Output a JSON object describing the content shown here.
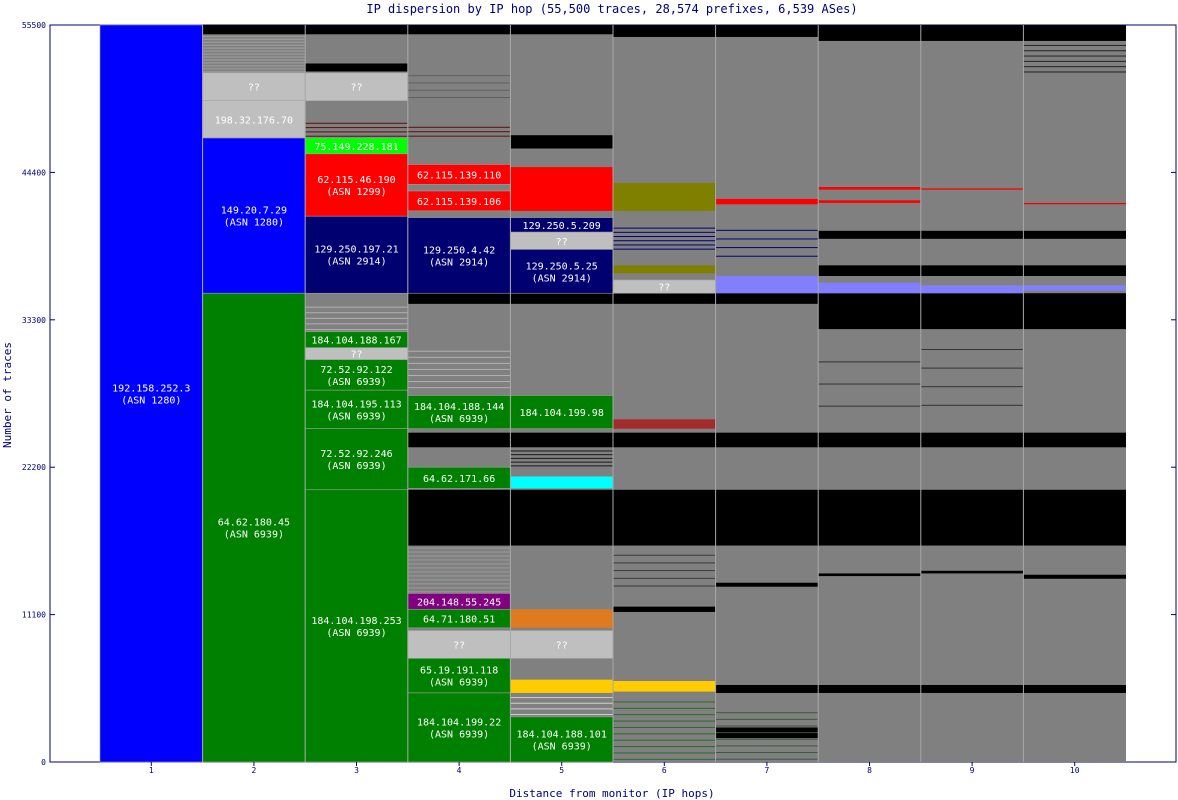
{
  "chart_data": {
    "type": "bar",
    "title": "IP dispersion by IP hop (55,500 traces, 28,574 prefixes, 6,539 ASes)",
    "xlabel": "Distance from monitor (IP hops)",
    "ylabel": "Number of traces",
    "ylim": [
      0,
      55500
    ],
    "yticks": [
      "0",
      "11100",
      "22200",
      "33300",
      "44400",
      "55500"
    ],
    "categories": [
      "1",
      "2",
      "3",
      "4",
      "5",
      "6",
      "7",
      "8",
      "9",
      "10"
    ],
    "colors": {
      "blue": "#0000ff",
      "navy": "#000070",
      "green": "#008000",
      "gray": "#808080",
      "lightgray": "#bfbfbf",
      "black": "#000000",
      "red": "#ff0000",
      "lime": "#00ff00",
      "olive": "#808000",
      "cyan": "#00ffff",
      "purple": "#800080",
      "orange": "#e07a1f",
      "gold": "#ffcc00",
      "brown": "#a52a2a",
      "lightblue": "#8080ff",
      "axis": "#00007a"
    },
    "labeled_segments": [
      {
        "hop": 1,
        "y0": 0,
        "y1": 55500,
        "color": "blue",
        "label": "192.158.252.3",
        "sub": "(ASN 1280)"
      },
      {
        "hop": 2,
        "y0": 35300,
        "y1": 47000,
        "color": "blue",
        "label": "149.20.7.29",
        "sub": "(ASN 1280)"
      },
      {
        "hop": 2,
        "y0": 0,
        "y1": 35300,
        "color": "green",
        "label": "64.62.180.45",
        "sub": "(ASN 6939)"
      },
      {
        "hop": 2,
        "y0": 47000,
        "y1": 49800,
        "color": "lightgray",
        "label": "198.32.176.70",
        "sub": ""
      },
      {
        "hop": 2,
        "y0": 49800,
        "y1": 51900,
        "color": "lightgray",
        "label": "??",
        "sub": ""
      },
      {
        "hop": 3,
        "y0": 45800,
        "y1": 47000,
        "color": "lime",
        "label": "75.149.228.181",
        "sub": ""
      },
      {
        "hop": 3,
        "y0": 41100,
        "y1": 45800,
        "color": "red",
        "label": "62.115.46.190",
        "sub": "(ASN 1299)"
      },
      {
        "hop": 3,
        "y0": 35300,
        "y1": 41100,
        "color": "navy",
        "label": "129.250.197.21",
        "sub": "(ASN 2914)"
      },
      {
        "hop": 3,
        "y0": 49800,
        "y1": 51900,
        "color": "lightgray",
        "label": "??",
        "sub": ""
      },
      {
        "hop": 3,
        "y0": 31200,
        "y1": 32400,
        "color": "green",
        "label": "184.104.188.167",
        "sub": ""
      },
      {
        "hop": 3,
        "y0": 30300,
        "y1": 31200,
        "color": "lightgray",
        "label": "??",
        "sub": ""
      },
      {
        "hop": 3,
        "y0": 28000,
        "y1": 30300,
        "color": "green",
        "label": "72.52.92.122",
        "sub": "(ASN 6939)"
      },
      {
        "hop": 3,
        "y0": 25100,
        "y1": 28000,
        "color": "green",
        "label": "184.104.195.113",
        "sub": "(ASN 6939)"
      },
      {
        "hop": 3,
        "y0": 20500,
        "y1": 25100,
        "color": "green",
        "label": "72.52.92.246",
        "sub": "(ASN 6939)"
      },
      {
        "hop": 3,
        "y0": 0,
        "y1": 20500,
        "color": "green",
        "label": "184.104.198.253",
        "sub": "(ASN 6939)"
      },
      {
        "hop": 4,
        "y0": 43500,
        "y1": 45000,
        "color": "red",
        "label": "62.115.139.110",
        "sub": ""
      },
      {
        "hop": 4,
        "y0": 41500,
        "y1": 43000,
        "color": "red",
        "label": "62.115.139.106",
        "sub": ""
      },
      {
        "hop": 4,
        "y0": 35300,
        "y1": 41000,
        "color": "navy",
        "label": "129.250.4.42",
        "sub": "(ASN 2914)"
      },
      {
        "hop": 4,
        "y0": 25100,
        "y1": 27600,
        "color": "green",
        "label": "184.104.188.144",
        "sub": "(ASN 6939)"
      },
      {
        "hop": 4,
        "y0": 20600,
        "y1": 22200,
        "color": "green",
        "label": "64.62.171.66",
        "sub": ""
      },
      {
        "hop": 4,
        "y0": 11500,
        "y1": 12700,
        "color": "purple",
        "label": "204.148.55.245",
        "sub": ""
      },
      {
        "hop": 4,
        "y0": 10100,
        "y1": 11500,
        "color": "green",
        "label": "64.71.180.51",
        "sub": ""
      },
      {
        "hop": 4,
        "y0": 7800,
        "y1": 9900,
        "color": "lightgray",
        "label": "??",
        "sub": ""
      },
      {
        "hop": 4,
        "y0": 5200,
        "y1": 7800,
        "color": "green",
        "label": "65.19.191.118",
        "sub": "(ASN 6939)"
      },
      {
        "hop": 4,
        "y0": 0,
        "y1": 5200,
        "color": "green",
        "label": "184.104.199.22",
        "sub": "(ASN 6939)"
      },
      {
        "hop": 5,
        "y0": 39900,
        "y1": 41000,
        "color": "navy",
        "label": "129.250.5.209",
        "sub": ""
      },
      {
        "hop": 5,
        "y0": 38600,
        "y1": 39900,
        "color": "lightgray",
        "label": "??",
        "sub": ""
      },
      {
        "hop": 5,
        "y0": 35300,
        "y1": 38600,
        "color": "navy",
        "label": "129.250.5.25",
        "sub": "(ASN 2914)"
      },
      {
        "hop": 5,
        "y0": 25100,
        "y1": 27600,
        "color": "green",
        "label": "184.104.199.98",
        "sub": ""
      },
      {
        "hop": 5,
        "y0": 7800,
        "y1": 9900,
        "color": "lightgray",
        "label": "??",
        "sub": ""
      },
      {
        "hop": 5,
        "y0": 0,
        "y1": 3400,
        "color": "green",
        "label": "184.104.188.101",
        "sub": "(ASN 6939)"
      },
      {
        "hop": 6,
        "y0": 35300,
        "y1": 36300,
        "color": "lightgray",
        "label": "??",
        "sub": ""
      }
    ],
    "unlabeled_segments": [
      {
        "hop": 5,
        "y0": 20600,
        "y1": 21500,
        "color": "cyan"
      },
      {
        "hop": 5,
        "y0": 10100,
        "y1": 11500,
        "color": "orange"
      },
      {
        "hop": 5,
        "y0": 5200,
        "y1": 6200,
        "color": "gold"
      },
      {
        "hop": 5,
        "y0": 41500,
        "y1": 44800,
        "color": "red"
      },
      {
        "hop": 6,
        "y0": 41500,
        "y1": 43600,
        "color": "olive"
      },
      {
        "hop": 6,
        "y0": 36800,
        "y1": 37400,
        "color": "olive"
      },
      {
        "hop": 6,
        "y0": 5300,
        "y1": 6100,
        "color": "gold"
      },
      {
        "hop": 6,
        "y0": 25100,
        "y1": 25800,
        "color": "brown"
      },
      {
        "hop": 7,
        "y0": 35300,
        "y1": 36600,
        "color": "lightblue"
      },
      {
        "hop": 8,
        "y0": 35300,
        "y1": 36100,
        "color": "lightblue"
      },
      {
        "hop": 9,
        "y0": 35300,
        "y1": 35900,
        "color": "lightblue"
      },
      {
        "hop": 10,
        "y0": 35500,
        "y1": 35900,
        "color": "lightblue"
      },
      {
        "hop": 7,
        "y0": 42000,
        "y1": 42400,
        "color": "red"
      },
      {
        "hop": 8,
        "y0": 43100,
        "y1": 43300,
        "color": "red"
      },
      {
        "hop": 8,
        "y0": 42100,
        "y1": 42300,
        "color": "red"
      },
      {
        "hop": 9,
        "y0": 43100,
        "y1": 43200,
        "color": "red"
      },
      {
        "hop": 10,
        "y0": 42000,
        "y1": 42100,
        "color": "red"
      }
    ],
    "black_segments": [
      {
        "hop": 2,
        "y0": 54800,
        "y1": 55500
      },
      {
        "hop": 3,
        "y0": 54800,
        "y1": 55500
      },
      {
        "hop": 4,
        "y0": 54800,
        "y1": 55500
      },
      {
        "hop": 5,
        "y0": 54800,
        "y1": 55500
      },
      {
        "hop": 6,
        "y0": 54600,
        "y1": 55500
      },
      {
        "hop": 7,
        "y0": 54600,
        "y1": 55500
      },
      {
        "hop": 8,
        "y0": 54300,
        "y1": 55500
      },
      {
        "hop": 9,
        "y0": 54300,
        "y1": 55500
      },
      {
        "hop": 10,
        "y0": 54300,
        "y1": 55500
      },
      {
        "hop": 4,
        "y0": 16300,
        "y1": 20500
      },
      {
        "hop": 5,
        "y0": 16300,
        "y1": 20500
      },
      {
        "hop": 6,
        "y0": 16300,
        "y1": 20500
      },
      {
        "hop": 7,
        "y0": 16300,
        "y1": 20500
      },
      {
        "hop": 8,
        "y0": 16300,
        "y1": 20500
      },
      {
        "hop": 9,
        "y0": 16300,
        "y1": 20500
      },
      {
        "hop": 10,
        "y0": 16300,
        "y1": 20500
      },
      {
        "hop": 4,
        "y0": 23700,
        "y1": 24800
      },
      {
        "hop": 5,
        "y0": 23700,
        "y1": 24800
      },
      {
        "hop": 6,
        "y0": 23700,
        "y1": 24800
      },
      {
        "hop": 7,
        "y0": 23700,
        "y1": 24800
      },
      {
        "hop": 8,
        "y0": 23700,
        "y1": 24800
      },
      {
        "hop": 9,
        "y0": 23700,
        "y1": 24800
      },
      {
        "hop": 10,
        "y0": 23700,
        "y1": 24800
      },
      {
        "hop": 4,
        "y0": 34500,
        "y1": 35300
      },
      {
        "hop": 5,
        "y0": 34500,
        "y1": 35300
      },
      {
        "hop": 6,
        "y0": 34500,
        "y1": 35300
      },
      {
        "hop": 7,
        "y0": 34500,
        "y1": 35300
      },
      {
        "hop": 8,
        "y0": 32600,
        "y1": 35300
      },
      {
        "hop": 9,
        "y0": 32600,
        "y1": 35300
      },
      {
        "hop": 10,
        "y0": 32600,
        "y1": 35300
      },
      {
        "hop": 8,
        "y0": 36600,
        "y1": 37400
      },
      {
        "hop": 9,
        "y0": 36600,
        "y1": 37400
      },
      {
        "hop": 10,
        "y0": 36600,
        "y1": 37400
      },
      {
        "hop": 8,
        "y0": 39400,
        "y1": 40000
      },
      {
        "hop": 9,
        "y0": 39400,
        "y1": 40000
      },
      {
        "hop": 10,
        "y0": 39400,
        "y1": 40000
      },
      {
        "hop": 7,
        "y0": 5200,
        "y1": 5800
      },
      {
        "hop": 8,
        "y0": 5200,
        "y1": 5800
      },
      {
        "hop": 9,
        "y0": 5200,
        "y1": 5800
      },
      {
        "hop": 10,
        "y0": 5200,
        "y1": 5800
      },
      {
        "hop": 7,
        "y0": 1800,
        "y1": 2600
      },
      {
        "hop": 6,
        "y0": 11300,
        "y1": 11700
      },
      {
        "hop": 7,
        "y0": 13200,
        "y1": 13500
      },
      {
        "hop": 8,
        "y0": 14000,
        "y1": 14200
      },
      {
        "hop": 9,
        "y0": 14200,
        "y1": 14400
      },
      {
        "hop": 10,
        "y0": 13800,
        "y1": 14100
      },
      {
        "hop": 3,
        "y0": 52000,
        "y1": 52600
      },
      {
        "hop": 5,
        "y0": 46200,
        "y1": 47200
      }
    ]
  }
}
